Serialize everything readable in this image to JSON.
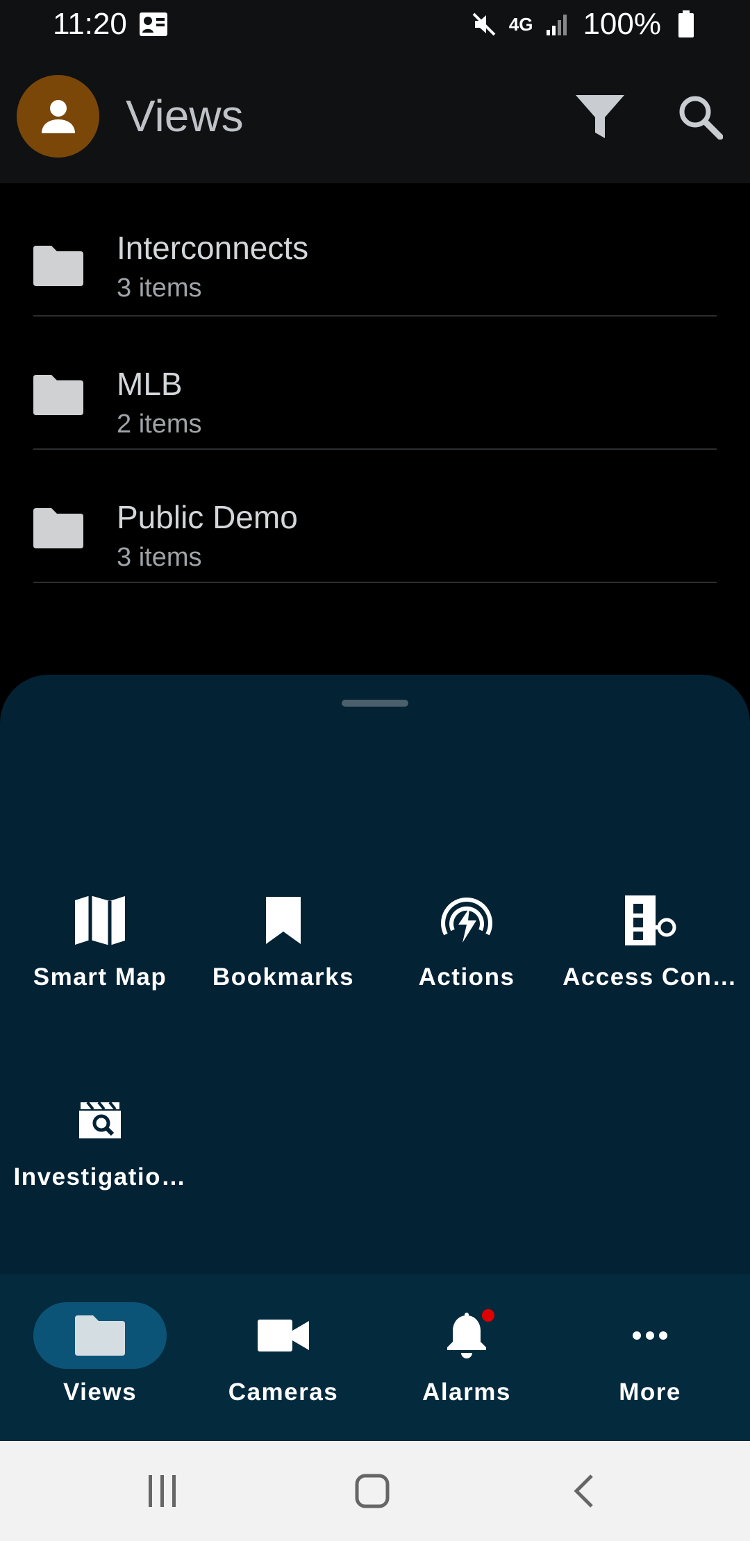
{
  "status_bar": {
    "time": "11:20",
    "network": "4G",
    "battery": "100%"
  },
  "app_bar": {
    "title": "Views",
    "avatar_color": "#7a4708"
  },
  "folders": [
    {
      "name": "Interconnects",
      "count": "3 items"
    },
    {
      "name": "MLB",
      "count": "2 items"
    },
    {
      "name": "Public Demo",
      "count": "3 items"
    }
  ],
  "sheet": {
    "items": [
      {
        "label": "Smart Map",
        "icon": "map-icon"
      },
      {
        "label": "Bookmarks",
        "icon": "bookmark-icon"
      },
      {
        "label": "Actions",
        "icon": "actions-icon"
      },
      {
        "label": "Access Con…",
        "icon": "access-control-icon"
      },
      {
        "label": "Investigatio…",
        "icon": "investigation-icon"
      }
    ]
  },
  "bottom_nav": {
    "items": [
      {
        "label": "Views",
        "icon": "folder-icon",
        "active": true
      },
      {
        "label": "Cameras",
        "icon": "camera-icon"
      },
      {
        "label": "Alarms",
        "icon": "bell-icon",
        "badge": true
      },
      {
        "label": "More",
        "icon": "more-icon"
      }
    ]
  },
  "colors": {
    "sheet_bg": "#032234",
    "nav_bg": "#042a3e",
    "active_pill": "#0b5478",
    "badge": "#e00000"
  }
}
